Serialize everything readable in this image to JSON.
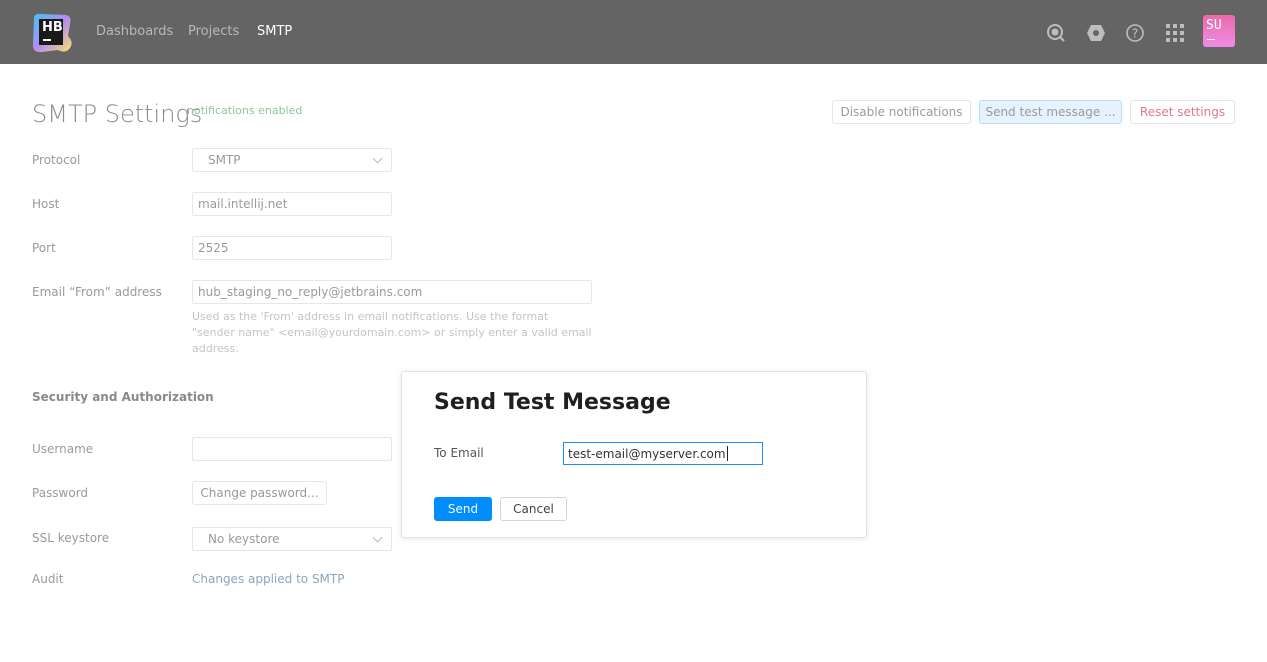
{
  "header": {
    "logo_text": "HB",
    "nav": [
      {
        "label": "Dashboards"
      },
      {
        "label": "Projects"
      },
      {
        "label": "SMTP",
        "active": true
      }
    ],
    "icons": [
      "search-icon",
      "settings-icon",
      "help-icon",
      "apps-grid-icon"
    ],
    "avatar": "SU"
  },
  "page": {
    "title": "SMTP Settings",
    "status_badge": "notifications enabled",
    "actions": {
      "disable": "Disable notifications",
      "send_test": "Send test message ...",
      "reset": "Reset settings"
    },
    "fields": {
      "protocol": {
        "label": "Protocol",
        "value": "SMTP"
      },
      "host": {
        "label": "Host",
        "value": "mail.intellij.net"
      },
      "port": {
        "label": "Port",
        "value": "2525"
      },
      "from": {
        "label": "Email “From” address",
        "value": "hub_staging_no_reply@jetbrains.com",
        "hint": "Used as the 'From' address in email notifications. Use the format \"sender name\" <email@yourdomain.com> or simply enter a valid email address."
      }
    },
    "security": {
      "title": "Security and Authorization",
      "username": {
        "label": "Username",
        "value": ""
      },
      "password": {
        "label": "Password",
        "button": "Change password..."
      },
      "ssl": {
        "label": "SSL keystore",
        "value": "No keystore"
      },
      "audit": {
        "label": "Audit",
        "link": "Changes applied to SMTP"
      }
    }
  },
  "dialog": {
    "title": "Send Test Message",
    "to_label": "To Email",
    "to_value": "test-email@myserver.com",
    "send": "Send",
    "cancel": "Cancel"
  },
  "colors": {
    "header": "#646464",
    "accent": "#008eff",
    "badge": "#8ec79a",
    "reset": "#e07a8c"
  }
}
